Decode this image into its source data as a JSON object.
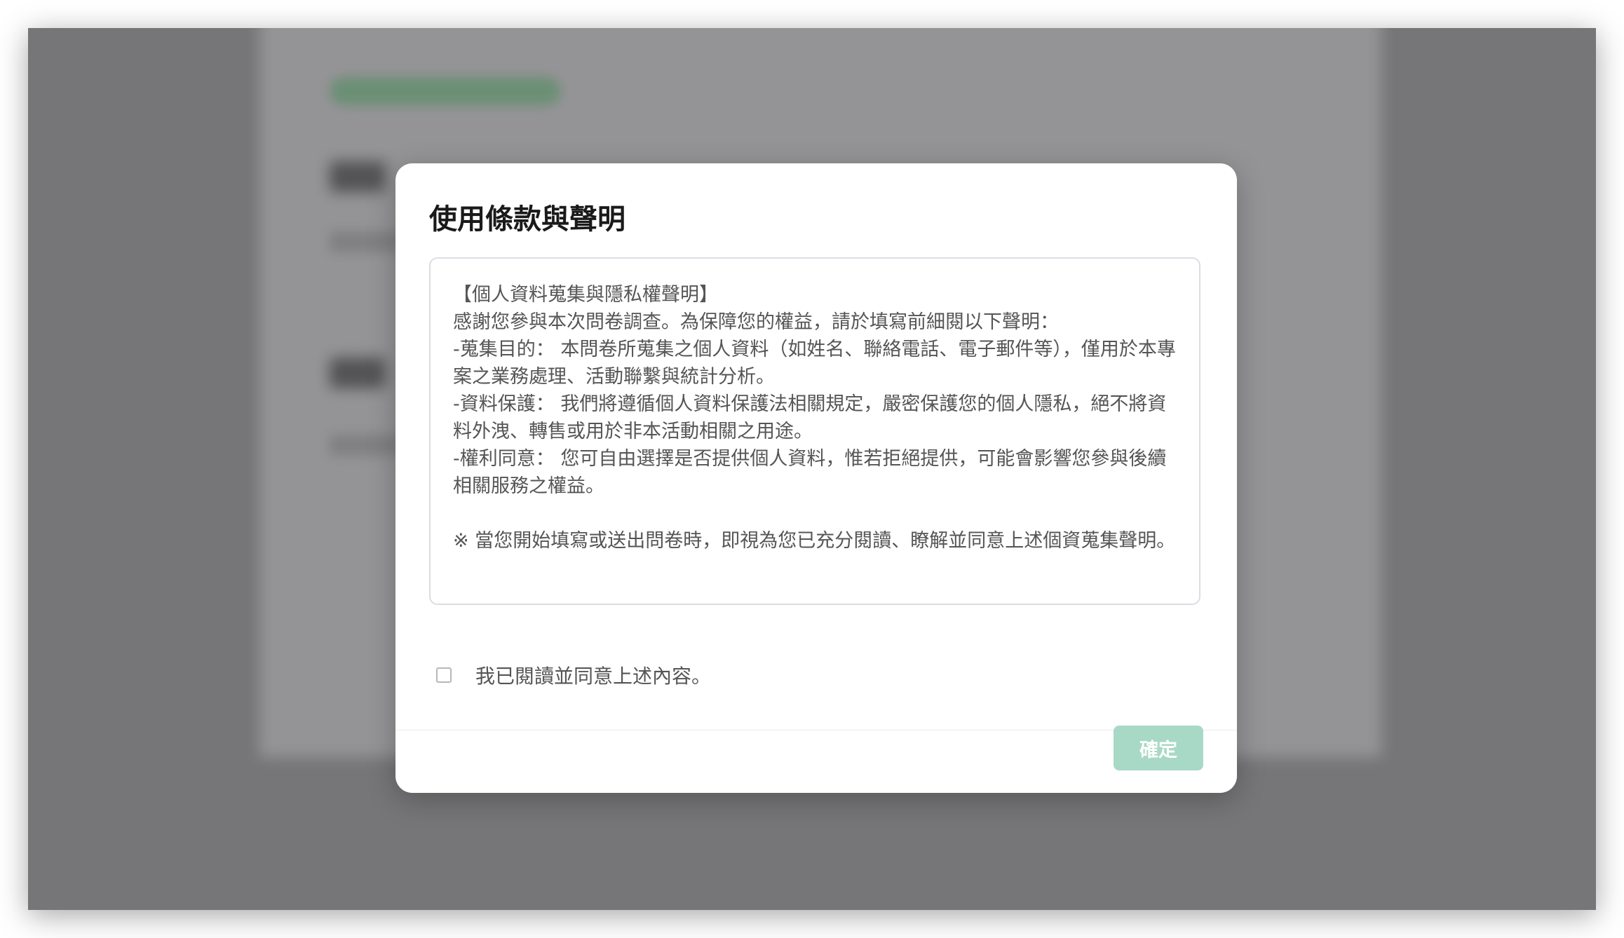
{
  "dialog": {
    "title": "使用條款與聲明",
    "terms": {
      "line_1": "【個人資料蒐集與隱私權聲明】",
      "line_2": "感謝您參與本次問卷調查。為保障您的權益，請於填寫前細閱以下聲明：",
      "line_3": "-蒐集目的： 本問卷所蒐集之個人資料（如姓名、聯絡電話、電子郵件等），僅用於本專案之業務處理、活動聯繫與統計分析。",
      "line_4": "-資料保護： 我們將遵循個人資料保護法相關規定，嚴密保護您的個人隱私，絕不將資料外洩、轉售或用於非本活動相關之用途。",
      "line_5": "-權利同意： 您可自由選擇是否提供個人資料，惟若拒絕提供，可能會影響您參與後續相關服務之權益。",
      "notice": "※ 當您開始填寫或送出問卷時，即視為您已充分閱讀、瞭解並同意上述個資蒐集聲明。"
    },
    "agree_label": "我已閱讀並同意上述內容。",
    "agree_checked": false,
    "confirm_label": "確定"
  },
  "colors": {
    "confirm_button_bg": "#a8d9c6",
    "overlay": "#8b8a8c"
  }
}
